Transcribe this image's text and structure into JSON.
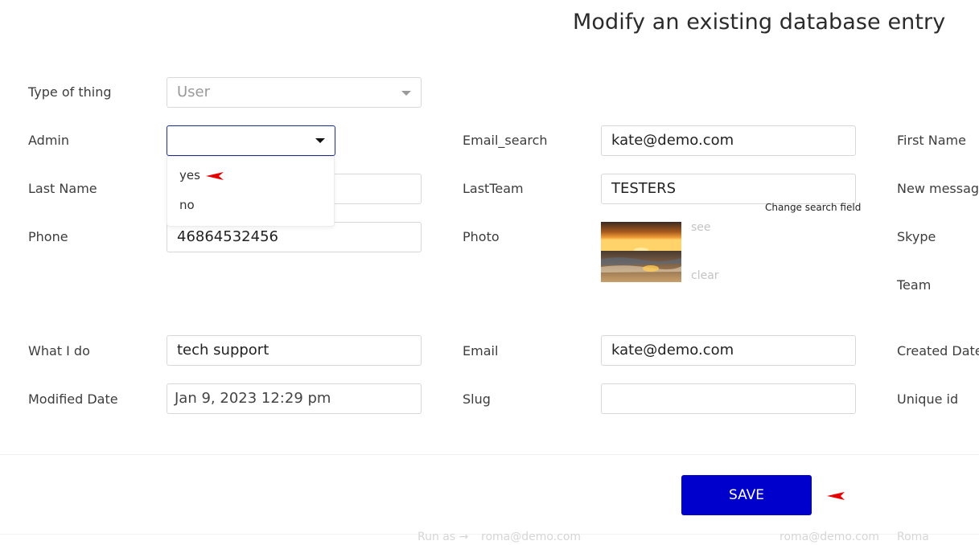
{
  "page_title": "Modify an existing database entry",
  "fields": {
    "type_of_thing": {
      "label": "Type of thing",
      "value": "User"
    },
    "admin": {
      "label": "Admin",
      "value": "",
      "options": [
        "yes",
        "no"
      ]
    },
    "email_search": {
      "label": "Email_search",
      "value": "kate@demo.com"
    },
    "first_name": {
      "label": "First Name"
    },
    "last_name": {
      "label": "Last Name",
      "value": ""
    },
    "last_team": {
      "label": "LastTeam",
      "value": "TESTERS",
      "hint": "Change search field"
    },
    "new_message": {
      "label": "New message"
    },
    "phone": {
      "label": "Phone",
      "value": "46864532456"
    },
    "photo": {
      "label": "Photo",
      "see_link": "see",
      "clear_link": "clear"
    },
    "skype": {
      "label": "Skype"
    },
    "team": {
      "label": "Team"
    },
    "what_i_do": {
      "label": "What I do",
      "value": "tech support"
    },
    "email": {
      "label": "Email",
      "value": "kate@demo.com"
    },
    "created_date": {
      "label": "Created Date"
    },
    "modified_date": {
      "label": "Modified Date",
      "value": "Jan 9, 2023 12:29 pm"
    },
    "slug": {
      "label": "Slug",
      "value": ""
    },
    "unique_id": {
      "label": "Unique id"
    }
  },
  "save_label": "SAVE",
  "footer_ghost": {
    "run_as": "Run as →",
    "run_as_email": "roma@demo.com",
    "user_email": "roma@demo.com",
    "user_name": "Roma"
  },
  "colors": {
    "save_button": "#0000cc",
    "annotation_arrow": "#e60000"
  }
}
